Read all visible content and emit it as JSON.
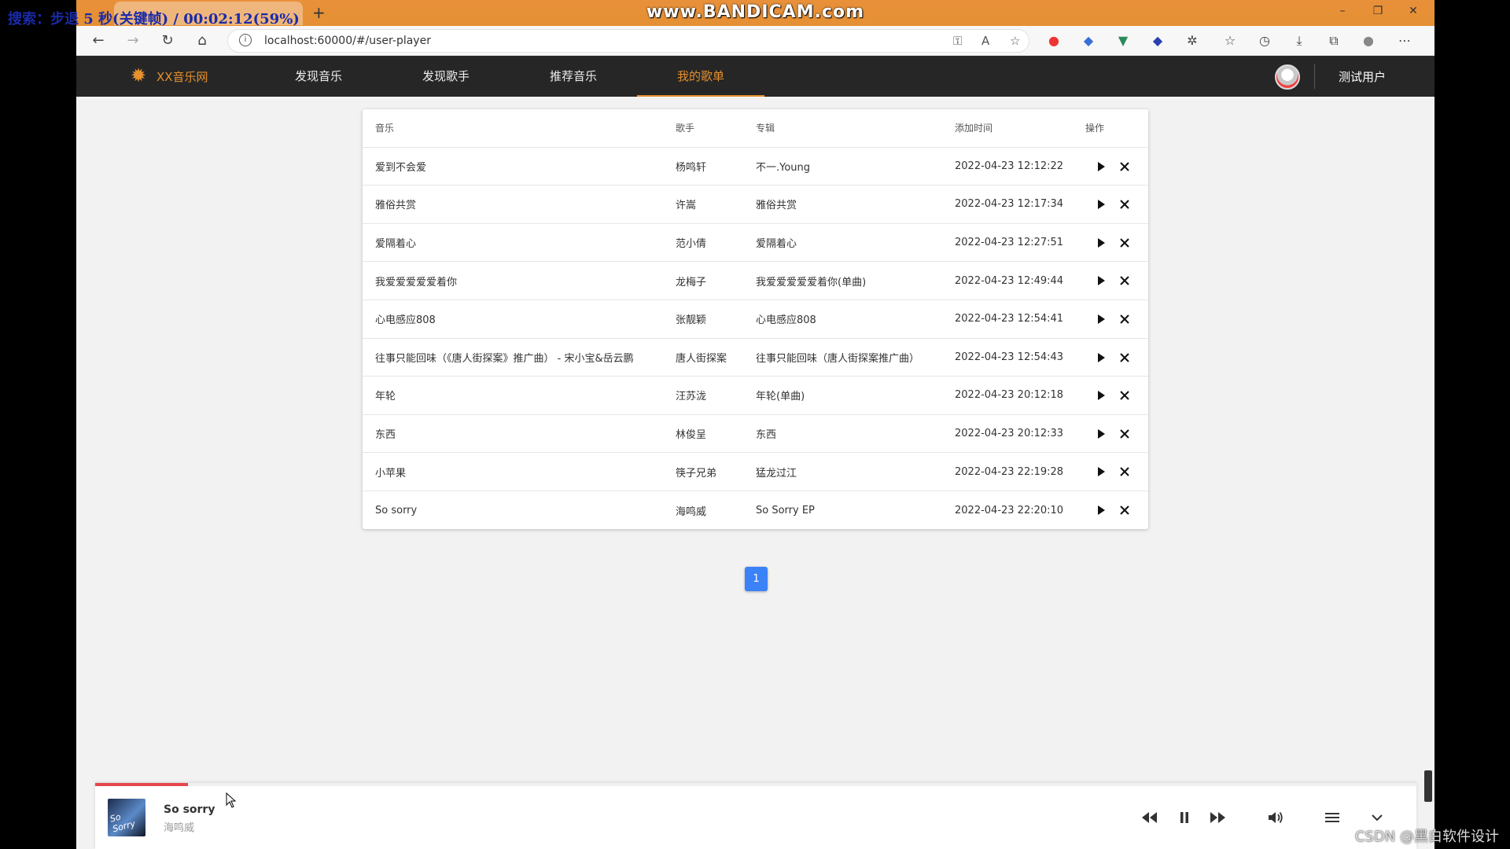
{
  "overlay": {
    "search_status": "搜索：步退 5 秒(关键帧) / 00:02:12(59%)",
    "recorder": "www.BANDICAM.com",
    "watermark": "CSDN @黑白软件设计"
  },
  "browser": {
    "url": "localhost:60000/#/user-player"
  },
  "app": {
    "logo_text": "XX音乐网",
    "nav": [
      {
        "label": "发现音乐"
      },
      {
        "label": "发现歌手"
      },
      {
        "label": "推荐音乐"
      },
      {
        "label": "我的歌单"
      }
    ],
    "active_nav": "我的歌单",
    "username": "测试用户"
  },
  "table": {
    "headers": {
      "music": "音乐",
      "singer": "歌手",
      "album": "专辑",
      "time": "添加时间",
      "op": "操作"
    },
    "rows": [
      {
        "music": "爱到不会爱",
        "singer": "杨鸣轩",
        "album": "不一.Young",
        "time": "2022-04-23 12:12:22"
      },
      {
        "music": "雅俗共赏",
        "singer": "许嵩",
        "album": "雅俗共赏",
        "time": "2022-04-23 12:17:34"
      },
      {
        "music": "爱隔着心",
        "singer": "范小倩",
        "album": "爱隔着心",
        "time": "2022-04-23 12:27:51"
      },
      {
        "music": "我爱爱爱爱爱着你",
        "singer": "龙梅子",
        "album": "我爱爱爱爱爱着你(单曲)",
        "time": "2022-04-23 12:49:44"
      },
      {
        "music": "心电感应808",
        "singer": "张靓颖",
        "album": "心电感应808",
        "time": "2022-04-23 12:54:41"
      },
      {
        "music": "往事只能回味（《唐人街探案》推广曲） - 宋小宝&岳云鹏",
        "singer": "唐人街探案",
        "album": "往事只能回味（唐人街探案推广曲）",
        "time": "2022-04-23 12:54:43"
      },
      {
        "music": "年轮",
        "singer": "汪苏泷",
        "album": "年轮(单曲)",
        "time": "2022-04-23 20:12:18"
      },
      {
        "music": "东西",
        "singer": "林俊呈",
        "album": "东西",
        "time": "2022-04-23 20:12:33"
      },
      {
        "music": "小苹果",
        "singer": "筷子兄弟",
        "album": "猛龙过江",
        "time": "2022-04-23 22:19:28"
      },
      {
        "music": "So sorry",
        "singer": "海鸣威",
        "album": "So Sorry EP",
        "time": "2022-04-23 22:20:10"
      }
    ]
  },
  "pagination": {
    "current_page": "1"
  },
  "player": {
    "title": "So sorry",
    "artist": "海鸣威",
    "cover_text": "So Sorry",
    "progress": 0.07,
    "colors": {
      "progress": "#e3474d"
    }
  },
  "colors": {
    "accent": "#e6902e",
    "nav_bg": "#262626",
    "page_btn": "#3b82f6"
  }
}
